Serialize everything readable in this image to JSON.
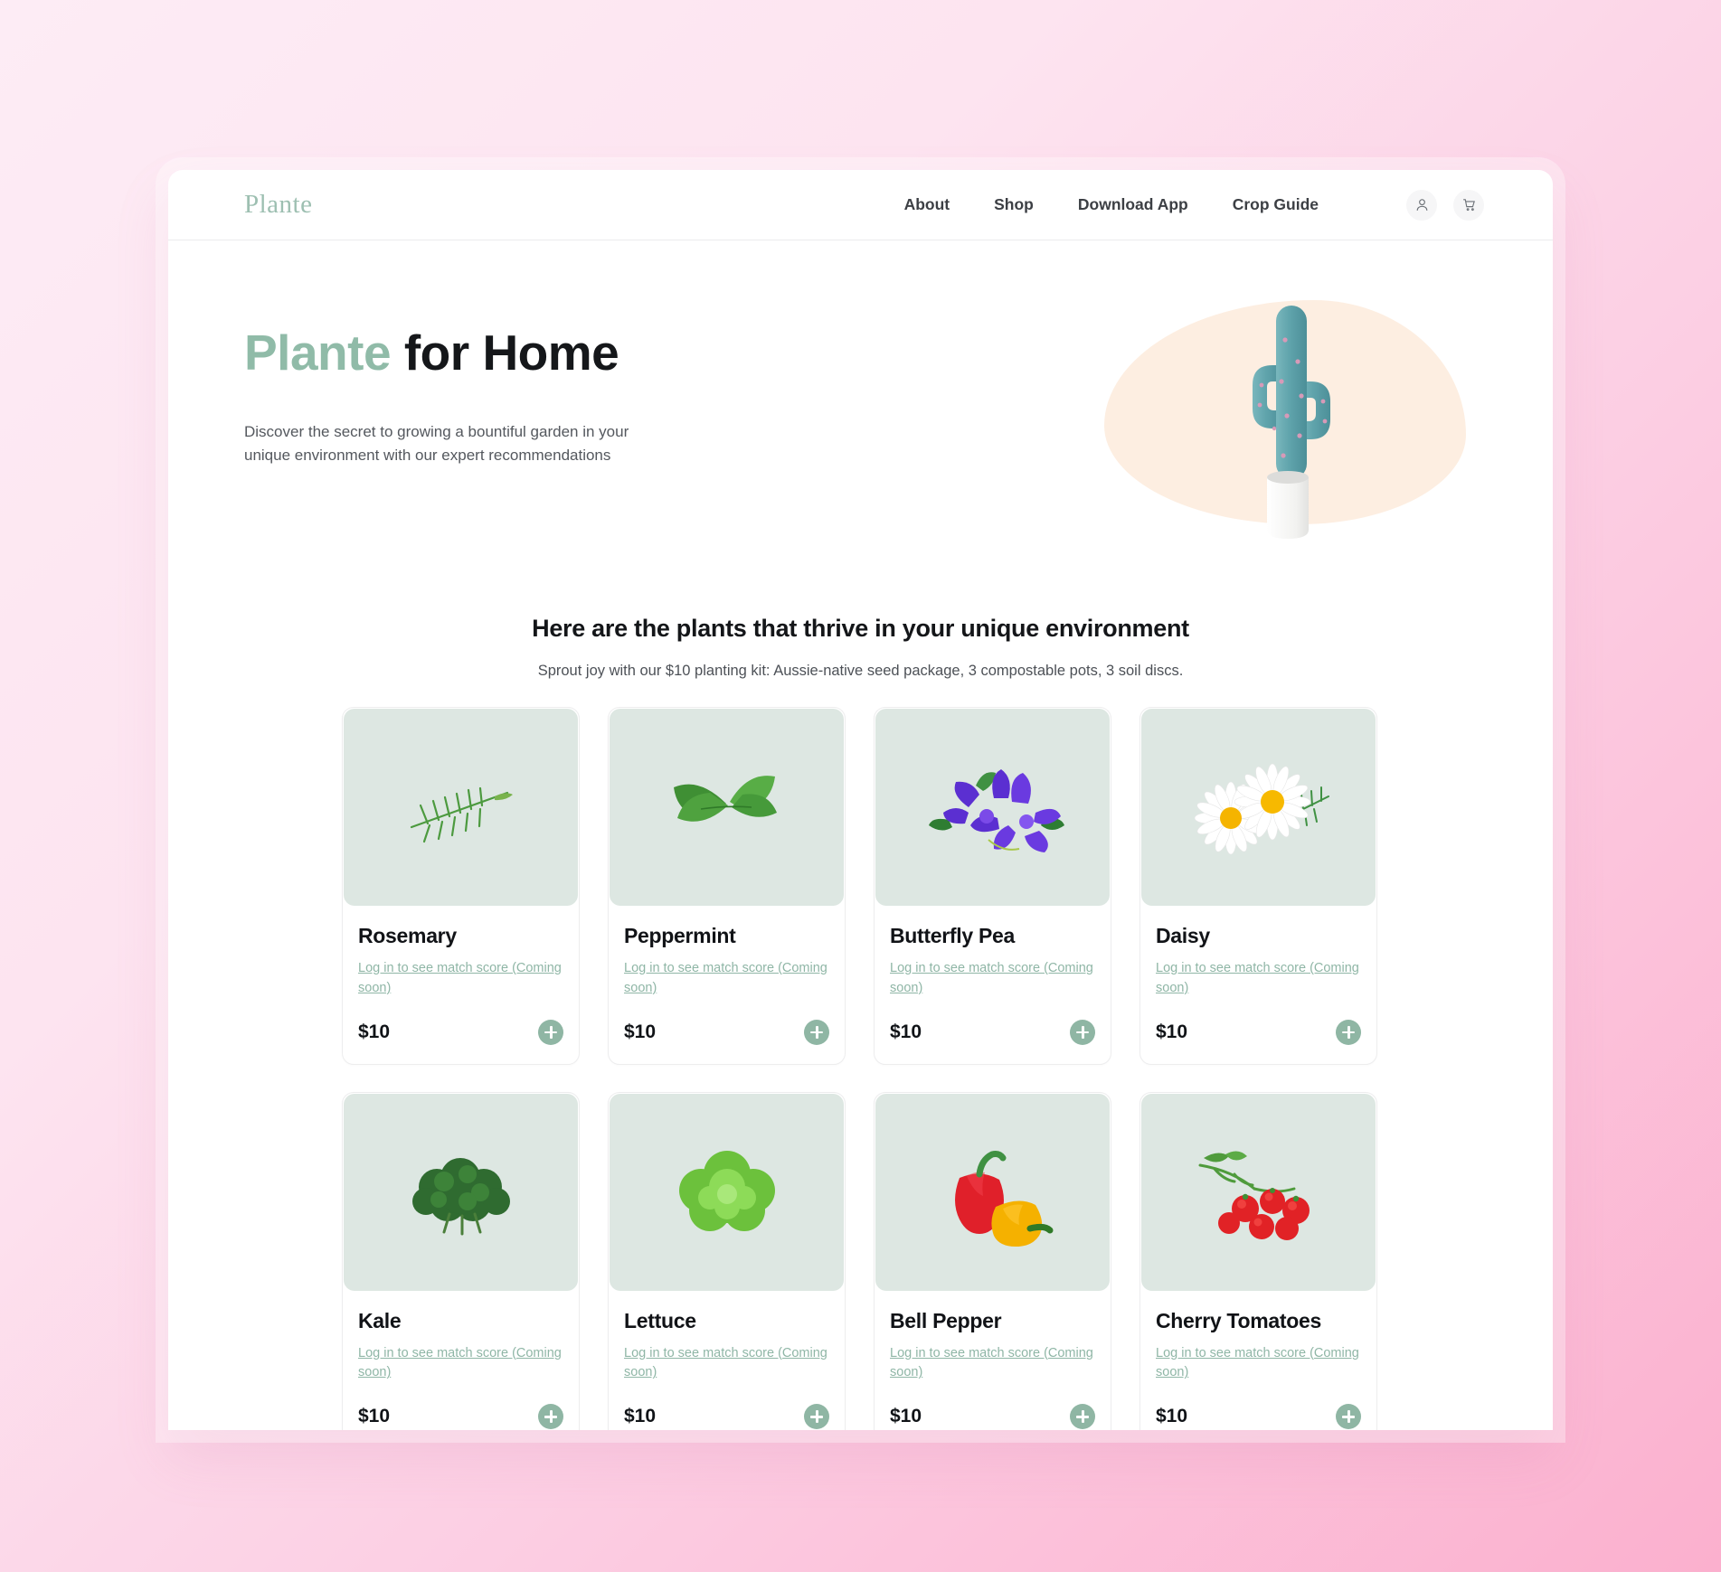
{
  "header": {
    "logo": "Plante",
    "nav": [
      {
        "label": "About"
      },
      {
        "label": "Shop"
      },
      {
        "label": "Download App"
      },
      {
        "label": "Crop Guide"
      }
    ],
    "icons": {
      "account": "user-icon",
      "cart": "shopping-cart-icon"
    }
  },
  "hero": {
    "title_accent": "Plante",
    "title_rest": " for Home",
    "subtitle": "Discover the secret to growing a bountiful garden in your unique environment with our expert recommendations",
    "illustration": "cactus-in-white-pot-illustration"
  },
  "products_section": {
    "heading": "Here are the plants that thrive in your unique environment",
    "subheading": "Sprout joy with our $10 planting kit: Aussie-native seed package, 3 compostable pots, 3 soil discs.",
    "match_score_link": "Log in to see match score (Coming soon)",
    "items": [
      {
        "name": "Rosemary",
        "price": "$10",
        "link": "Log in to see match score (Coming soon)",
        "image": "rosemary-sprig"
      },
      {
        "name": "Peppermint",
        "price": "$10",
        "link": "Log in to see match score (Coming soon)",
        "image": "peppermint-leaves"
      },
      {
        "name": "Butterfly Pea",
        "price": "$10",
        "link": "Log in to see match score (Coming soon)",
        "image": "butterfly-pea-flowers"
      },
      {
        "name": "Daisy",
        "price": "$10",
        "link": "Log in to see match score (Coming soon)",
        "image": "daisy-flowers"
      },
      {
        "name": "Kale",
        "price": "$10",
        "link": "Log in to see match score (Coming soon)",
        "image": "kale-bunch"
      },
      {
        "name": "Lettuce",
        "price": "$10",
        "link": "Log in to see match score (Coming soon)",
        "image": "lettuce-head"
      },
      {
        "name": "Bell Pepper",
        "price": "$10",
        "link": "Log in to see match score (Coming soon)",
        "image": "red-and-yellow-bell-peppers"
      },
      {
        "name": "Cherry Tomatoes",
        "price": "$10",
        "link": "Log in to see match score (Coming soon)",
        "image": "cherry-tomatoes-on-vine"
      }
    ]
  },
  "colors": {
    "brand_sage": "#90bba8",
    "accent_button": "#8fb6a4",
    "card_media_bg": "#dde7e2",
    "hero_blob": "#fdeee1",
    "page_gradient_start": "#fdecf5",
    "page_gradient_end": "#fbb0ce",
    "text_dark": "#15171a"
  }
}
